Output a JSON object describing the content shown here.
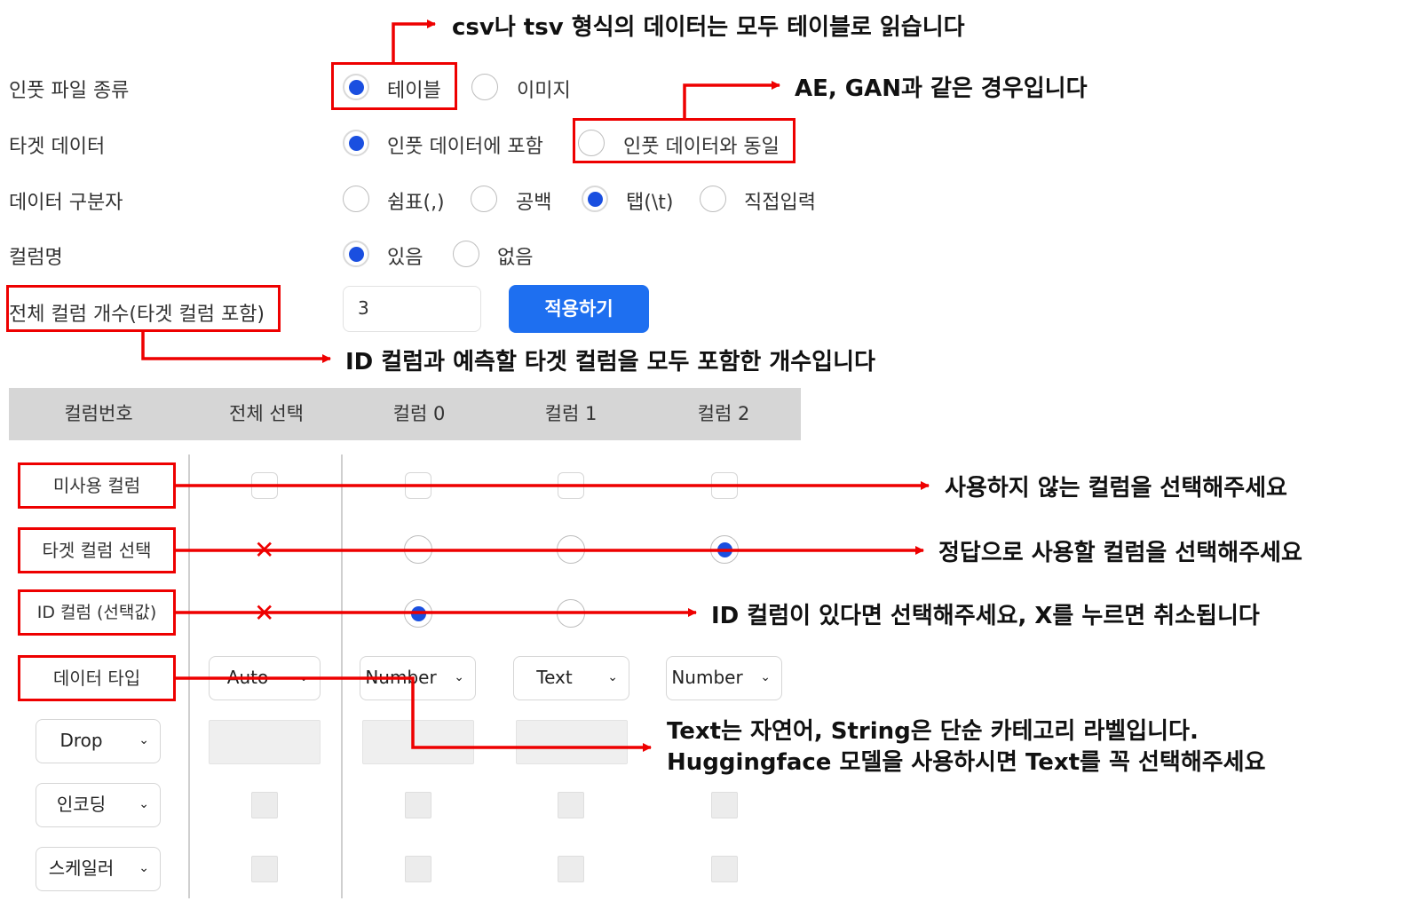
{
  "form": {
    "input_type": {
      "label": "인풋 파일 종류",
      "options": [
        "테이블",
        "이미지"
      ],
      "selected": "테이블"
    },
    "target_data": {
      "label": "타겟 데이터",
      "options": [
        "인풋 데이터에 포함",
        "인풋 데이터와 동일"
      ],
      "selected": "인풋 데이터에 포함"
    },
    "delimiter": {
      "label": "데이터 구분자",
      "options": [
        "쉼표(,)",
        "공백",
        "탭(\\t)",
        "직접입력"
      ],
      "selected": "탭(\\t)"
    },
    "header": {
      "label": "컬럼명",
      "options": [
        "있음",
        "없음"
      ],
      "selected": "있음"
    },
    "column_count": {
      "label": "전체 컬럼 개수(타겟 컬럼 포함)",
      "value": "3",
      "apply_label": "적용하기"
    }
  },
  "table": {
    "headers": [
      "컬럼번호",
      "전체 선택",
      "컬럼 0",
      "컬럼 1",
      "컬럼 2"
    ],
    "rows": {
      "unused": "미사용 컬럼",
      "target": "타겟 컬럼 선택",
      "id": "ID 컬럼 (선택값)",
      "dtype": "데이터 타입",
      "drop": "Drop",
      "encoding": "인코딩",
      "scaler": "스케일러"
    },
    "dtype_values": [
      "Auto",
      "Number",
      "Text",
      "Number"
    ],
    "target_selected_column": "컬럼 2",
    "id_selected_column": "컬럼 0",
    "clear_mark": "✕",
    "chevron": "⌄"
  },
  "annotations": {
    "csv_tsv": "csv나 tsv 형식의 데이터는 모두 테이블로 읽습니다",
    "ae_gan": "AE, GAN과 같은 경우입니다",
    "column_count": "ID 컬럼과 예측할 타겟 컬럼을 모두 포함한 개수입니다",
    "unused": "사용하지 않는 컬럼을 선택해주세요",
    "target": "정답으로 사용할 컬럼을 선택해주세요",
    "id": "ID 컬럼이 있다면 선택해주세요, X를 누르면 취소됩니다",
    "dtype_line1": "Text는 자연어, String은 단순 카테고리 라벨입니다.",
    "dtype_line2": "Huggingface 모델을 사용하시면 Text를 꼭 선택해주세요"
  },
  "colors": {
    "accent": "#1a4fe0",
    "button": "#1e6ff0",
    "annotation": "#ee0000",
    "header_bg": "#d6d6d6"
  }
}
